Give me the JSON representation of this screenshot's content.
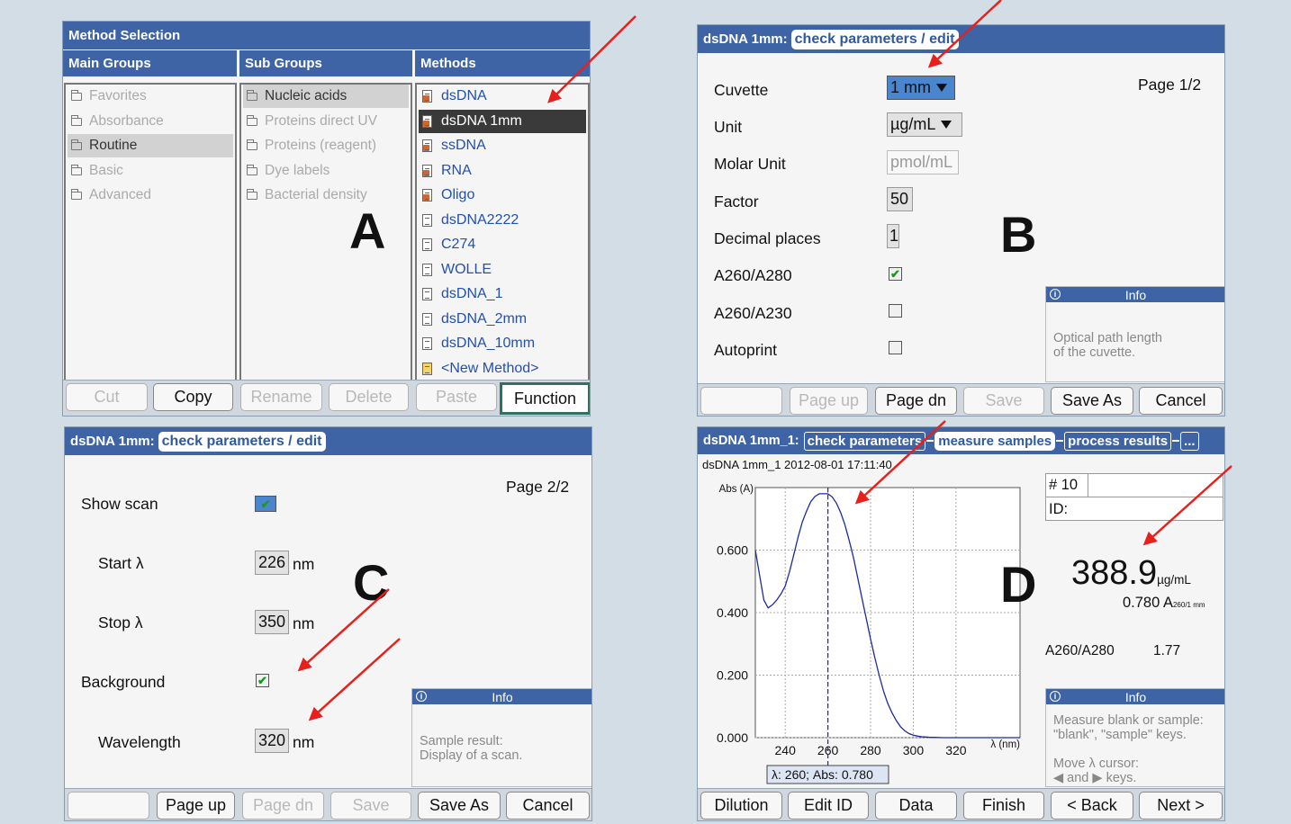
{
  "panelA": {
    "title": "Method Selection",
    "col_main": "Main Groups",
    "col_sub": "Sub Groups",
    "col_methods": "Methods",
    "main_groups": [
      "Favorites",
      "Absorbance",
      "Routine",
      "Basic",
      "Advanced"
    ],
    "sub_groups": [
      "Nucleic acids",
      "Proteins direct UV",
      "Proteins (reagent)",
      "Dye labels",
      "Bacterial density"
    ],
    "methods": [
      "dsDNA",
      "dsDNA 1mm",
      "ssDNA",
      "RNA",
      "Oligo",
      "dsDNA2222",
      "C274",
      "WOLLE",
      "dsDNA_1",
      "dsDNA_2mm",
      "dsDNA_10mm",
      "<New Method>"
    ],
    "buttons": [
      "Cut",
      "Copy",
      "Rename",
      "Delete",
      "Paste",
      "Function"
    ],
    "letter": "A"
  },
  "panelB": {
    "prefix": "dsDNA 1mm:",
    "tab": "check parameters / edit",
    "page": "Page 1/2",
    "labels": [
      "Cuvette",
      "Unit",
      "Molar Unit",
      "Factor",
      "Decimal places",
      "A260/A280",
      "A260/A230",
      "Autoprint"
    ],
    "cuvette": "1 mm",
    "unit": "µg/mL",
    "molar_unit": "pmol/mL",
    "factor": "50",
    "decimals": "1",
    "info_title": "Info",
    "info_text": "Optical path length\nof the cuvette.",
    "buttons": [
      "",
      "Page up",
      "Page dn",
      "Save",
      "Save As",
      "Cancel"
    ],
    "letter": "B"
  },
  "panelC": {
    "prefix": "dsDNA 1mm:",
    "tab": "check parameters / edit",
    "page": "Page 2/2",
    "labels": [
      "Show scan",
      "Start λ",
      "Stop λ",
      "Background",
      "Wavelength"
    ],
    "start": "226",
    "stop": "350",
    "wavelength": "320",
    "unit_nm": "nm",
    "info_title": "Info",
    "info_text": "Sample result:\nDisplay of a scan.",
    "buttons": [
      "",
      "Page up",
      "Page dn",
      "Save",
      "Save As",
      "Cancel"
    ],
    "letter": "C"
  },
  "panelD": {
    "prefix": "dsDNA 1mm_1:",
    "tabs": [
      "check parameters",
      "measure samples",
      "process results",
      "..."
    ],
    "sample_header": "dsDNA 1mm_1 2012-08-01 17:11:40",
    "y_label": "Abs (A)",
    "x_label": "λ (nm)",
    "cursor_readout": "λ: 260; Abs: 0.780",
    "sample_no": "# 10",
    "id_label": "ID:",
    "result_value": "388.9",
    "result_unit": "µg/mL",
    "abs_value": "0.780 A",
    "abs_sub": "260/1 mm",
    "ratio_label": "A260/A280",
    "ratio_value": "1.77",
    "info_title": "Info",
    "info_text": "Measure blank or sample:\n\"blank\", \"sample\" keys.\n\nMove λ cursor:\n◀ and ▶ keys.",
    "buttons": [
      "Dilution",
      "Edit ID",
      "Data",
      "Finish",
      "< Back",
      "Next >"
    ],
    "letter": "D"
  },
  "chart_data": {
    "type": "line",
    "xlabel": "λ (nm)",
    "ylabel": "Abs (A)",
    "xlim": [
      226,
      350
    ],
    "ylim": [
      0,
      0.8
    ],
    "x_ticks": [
      240,
      260,
      280,
      300,
      320
    ],
    "y_ticks": [
      "0.000",
      "0.200",
      "0.400",
      "0.600"
    ],
    "grid": true,
    "cursor_x": 260,
    "series": [
      {
        "x": [
          226,
          228,
          230,
          232,
          234,
          236,
          238,
          240,
          242,
          244,
          246,
          248,
          250,
          252,
          254,
          256,
          258,
          260,
          262,
          264,
          266,
          268,
          270,
          272,
          274,
          276,
          278,
          280,
          282,
          284,
          286,
          288,
          290,
          292,
          294,
          296,
          298,
          300,
          302,
          304,
          306,
          308,
          310,
          314,
          318,
          322,
          326,
          330,
          335,
          340,
          345,
          350
        ],
        "y": [
          0.6,
          0.52,
          0.44,
          0.415,
          0.425,
          0.44,
          0.46,
          0.485,
          0.53,
          0.585,
          0.64,
          0.69,
          0.725,
          0.755,
          0.772,
          0.78,
          0.78,
          0.78,
          0.77,
          0.75,
          0.72,
          0.68,
          0.63,
          0.575,
          0.51,
          0.445,
          0.38,
          0.315,
          0.255,
          0.2,
          0.15,
          0.11,
          0.08,
          0.055,
          0.035,
          0.022,
          0.013,
          0.008,
          0.005,
          0.003,
          0.002,
          0.001,
          0.001,
          0.0,
          0.0,
          0.0,
          0.0,
          0.0,
          0.0,
          0.0,
          0.0,
          0.0
        ]
      }
    ]
  }
}
